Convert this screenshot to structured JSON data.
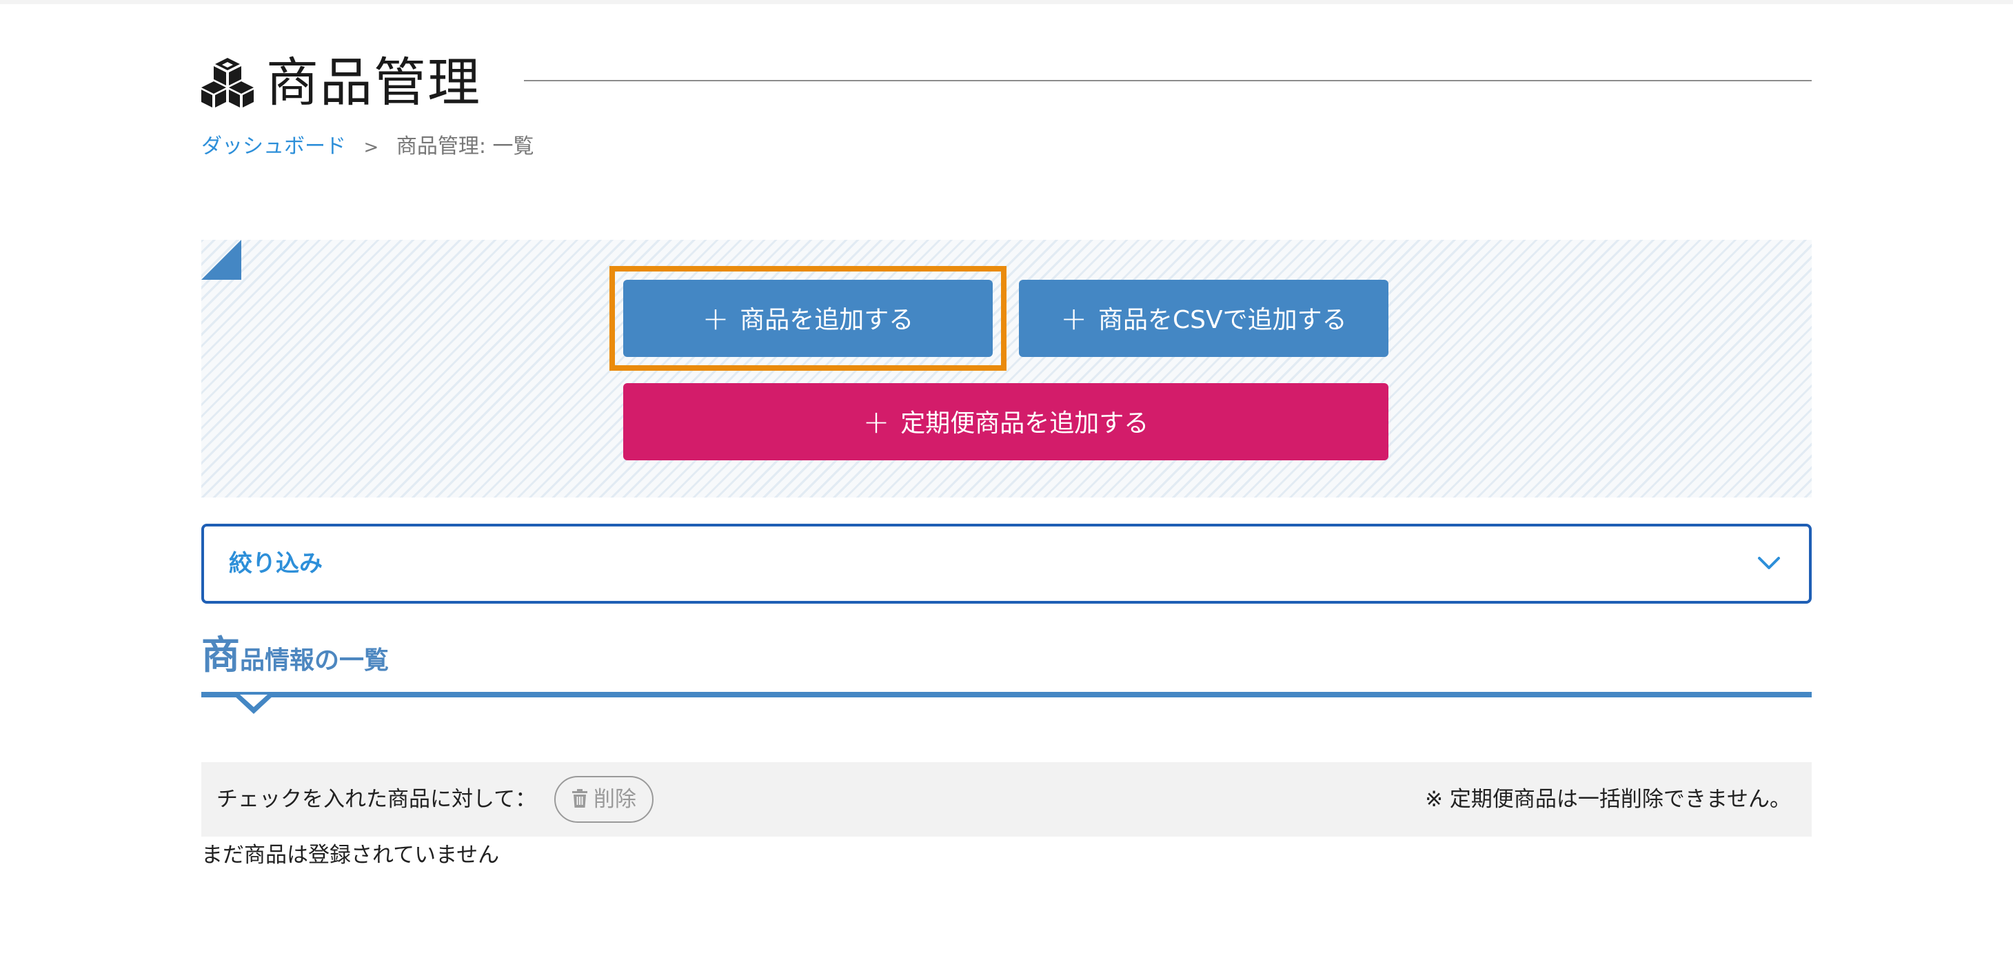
{
  "header": {
    "title": "商品管理",
    "icon": "cubes-icon"
  },
  "breadcrumb": {
    "home": "ダッシュボード",
    "separator": ">",
    "current": "商品管理: 一覧"
  },
  "actions": {
    "add_product": "商品を追加する",
    "add_csv": "商品をCSVで追加する",
    "add_subscription": "定期便商品を追加する",
    "plus_glyph": "+"
  },
  "filter": {
    "label": "絞り込み"
  },
  "section": {
    "title_first": "商",
    "title_rest": "品情報の一覧"
  },
  "bulk": {
    "label": "チェックを入れた商品に対して：",
    "delete_label": "削除",
    "note": "※ 定期便商品は一括削除できません。"
  },
  "empty_message": "まだ商品は登録されていません",
  "colors": {
    "primary_blue": "#4487c4",
    "subscription_pink": "#d31c6a",
    "highlight_orange": "#ea8b0c",
    "link_blue": "#2d8fd9",
    "filter_border": "#1f5fb5"
  }
}
